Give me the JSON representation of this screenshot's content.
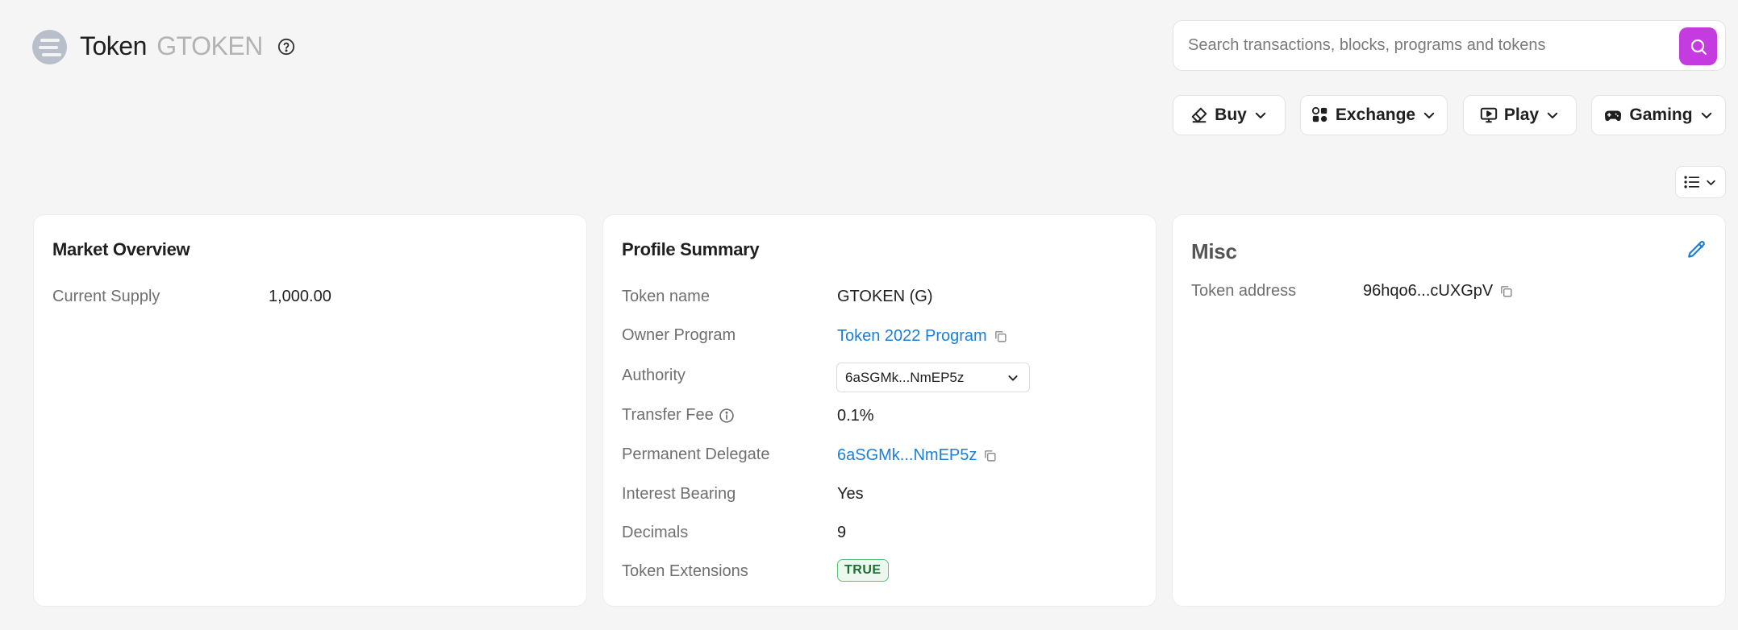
{
  "header": {
    "title": "Token",
    "subtitle": "GTOKEN",
    "search_placeholder": "Search transactions, blocks, programs and tokens"
  },
  "nav": {
    "buy": "Buy",
    "exchange": "Exchange",
    "play": "Play",
    "gaming": "Gaming"
  },
  "market_overview": {
    "title": "Market Overview",
    "current_supply_label": "Current Supply",
    "current_supply_value": "1,000.00"
  },
  "profile_summary": {
    "title": "Profile Summary",
    "rows": {
      "token_name_label": "Token name",
      "token_name_value": "GTOKEN (G)",
      "owner_program_label": "Owner Program",
      "owner_program_value": "Token 2022 Program",
      "authority_label": "Authority",
      "authority_value": "6aSGMk...NmEP5z",
      "transfer_fee_label": "Transfer Fee",
      "transfer_fee_value": "0.1%",
      "permanent_delegate_label": "Permanent Delegate",
      "permanent_delegate_value": "6aSGMk...NmEP5z",
      "interest_bearing_label": "Interest Bearing",
      "interest_bearing_value": "Yes",
      "decimals_label": "Decimals",
      "decimals_value": "9",
      "token_extensions_label": "Token Extensions",
      "token_extensions_value": "TRUE"
    }
  },
  "misc": {
    "title": "Misc",
    "token_address_label": "Token address",
    "token_address_value": "96hqo6...cUXGpV"
  },
  "colors": {
    "accent_search": "#c43be0",
    "link": "#1a7fd9",
    "badge_green": "#59c27b",
    "background": "#f5f5f5"
  },
  "icons": {
    "logo": "solana-logo-icon",
    "help": "question-circle-icon",
    "search": "search-icon",
    "buy": "card-icon",
    "exchange": "exchange-icon",
    "play": "monitor-play-icon",
    "gaming": "gamepad-icon",
    "chevron": "chevron-down-icon",
    "list": "list-icon",
    "copy": "copy-icon",
    "info": "info-circle-icon",
    "edit": "pencil-icon"
  }
}
